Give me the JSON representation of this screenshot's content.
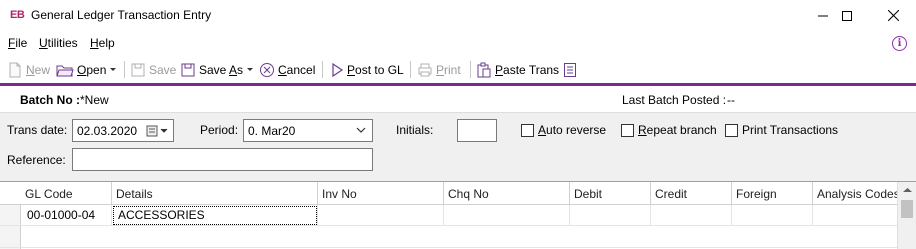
{
  "window": {
    "logo": "EB",
    "title": "General Ledger Transaction Entry",
    "minimize_icon": "minimize-icon",
    "maximize_icon": "maximize-icon",
    "close_icon": "close-icon"
  },
  "menu": {
    "file": {
      "underline": "F",
      "rest": "ile"
    },
    "utilities": {
      "underline": "U",
      "rest": "tilities"
    },
    "help": {
      "underline": "H",
      "rest": "elp"
    },
    "info_icon": "i"
  },
  "toolbar": {
    "new_u": "N",
    "new_rest": "ew",
    "open_u": "O",
    "open_rest": "pen",
    "save": "Save",
    "saveas_pre": "Save ",
    "saveas_u": "A",
    "saveas_rest": "s",
    "cancel_u": "C",
    "cancel_rest": "ancel",
    "post_u": "P",
    "post_rest": "ost to GL",
    "print_u": "P",
    "print_rest": "rint",
    "paste_u": "P",
    "paste_rest": "aste Trans"
  },
  "batch": {
    "label": "Batch No :",
    "value": "*New",
    "last_label": "Last Batch Posted :",
    "last_value": "--"
  },
  "form": {
    "trans_date_label": "Trans date:",
    "trans_date_value": "02.03.2020",
    "period_label": "Period:",
    "period_value": "0. Mar20",
    "initials_label": "Initials:",
    "initials_value": "",
    "auto_reverse_u": "A",
    "auto_reverse_rest": "uto reverse",
    "repeat_u": "R",
    "repeat_rest": "epeat branch",
    "print_trans": "Print Transactions",
    "reference_label": "Reference:",
    "reference_value": ""
  },
  "grid": {
    "columns": [
      "GL Code",
      "Details",
      "Inv No",
      "Chq No",
      "Debit",
      "Credit",
      "Foreign",
      "Analysis Codes"
    ],
    "rows": [
      {
        "gl_code": "00-01000-04",
        "details": "ACCESSORIES",
        "inv_no": "",
        "chq_no": "",
        "debit": "",
        "credit": "",
        "foreign": "",
        "analysis": ""
      }
    ]
  },
  "colors": {
    "accent": "#7a2a8c",
    "logo": "#b0246b"
  }
}
